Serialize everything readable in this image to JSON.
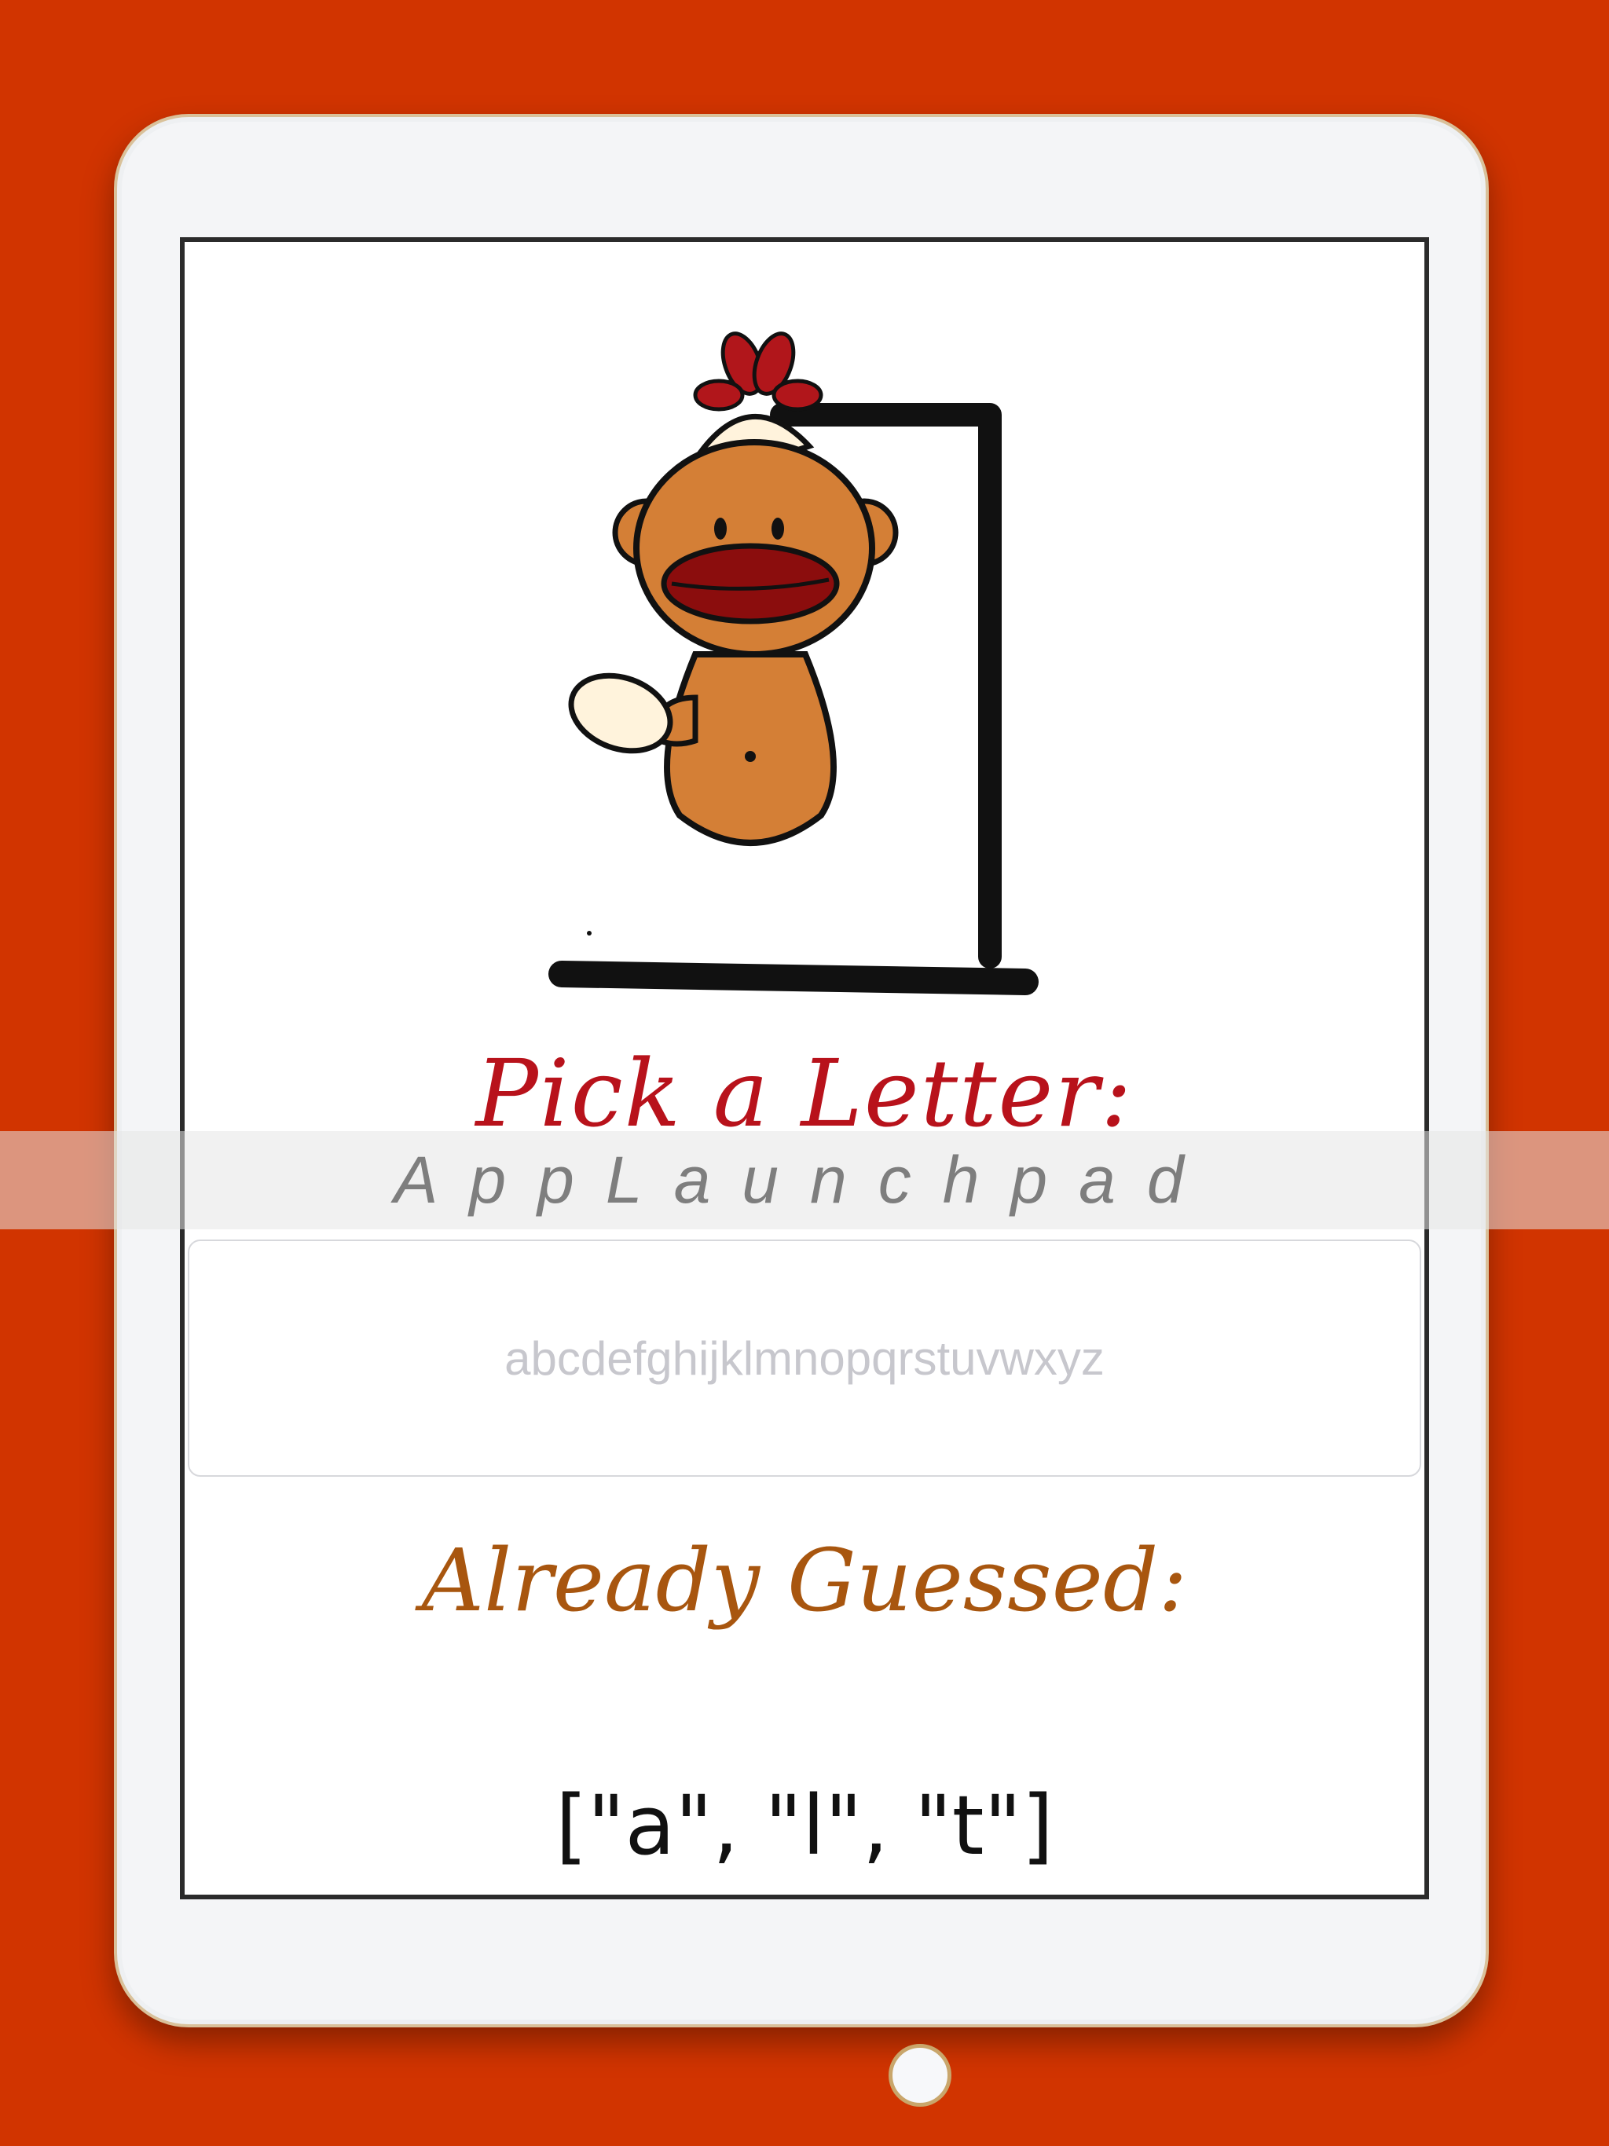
{
  "app": {
    "pick_label": "Pick a Letter:",
    "letters_placeholder": "abcdefghijklmnopqrstuvwxyz",
    "letters_value": "",
    "guessed_label": "Already Guessed:",
    "guessed_letters": "[\"a\", \"l\", \"t\"]"
  },
  "banner": {
    "text": "AppLaunchpad"
  },
  "colors": {
    "background": "#d13400",
    "pick_label": "#b8121b",
    "guessed_label": "#a8560f"
  },
  "icons": {
    "illustration": "sock-monkey-hangman-icon",
    "camera": "camera-icon",
    "home": "home-button-icon"
  }
}
